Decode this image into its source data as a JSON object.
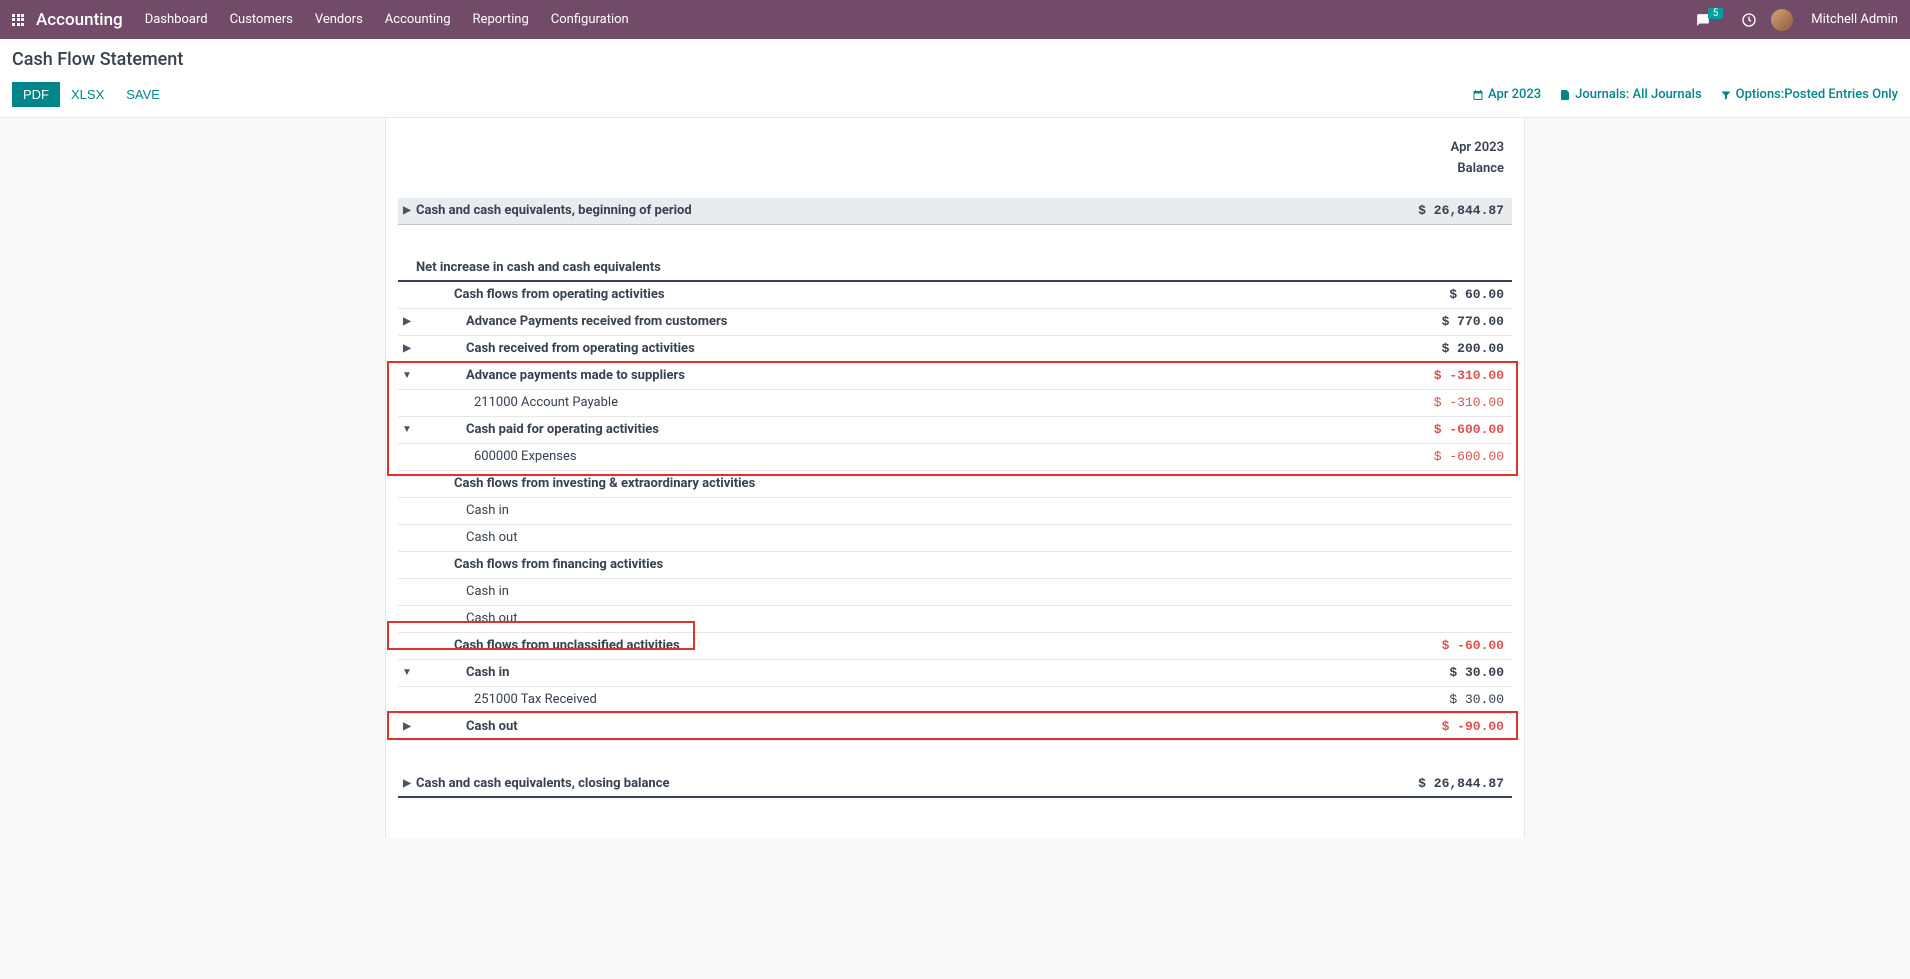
{
  "topbar": {
    "brand": "Accounting",
    "menu": [
      "Dashboard",
      "Customers",
      "Vendors",
      "Accounting",
      "Reporting",
      "Configuration"
    ],
    "notifications": "5",
    "user": "Mitchell Admin"
  },
  "page": {
    "title": "Cash Flow Statement"
  },
  "toolbar": {
    "pdf": "PDF",
    "xlsx": "XLSX",
    "save": "SAVE",
    "date_filter": "Apr 2023",
    "journals_filter": "Journals: All Journals",
    "options_filter": "Options:Posted Entries Only"
  },
  "report": {
    "period": "Apr 2023",
    "balance_label": "Balance",
    "rows": [
      {
        "label": "Cash and cash equivalents, beginning of period",
        "amount": "$ 26,844.87",
        "neg": false,
        "level": 0,
        "caret": "right",
        "shaded": true
      },
      {
        "gap": true
      },
      {
        "label": "Net increase in cash and cash equivalents",
        "amount": "",
        "neg": false,
        "level": 0,
        "caret": "",
        "section": true
      },
      {
        "label": "Cash flows from operating activities",
        "amount": "$ 60.00",
        "neg": false,
        "level": 1,
        "caret": ""
      },
      {
        "label": "Advance Payments received from customers",
        "amount": "$ 770.00",
        "neg": false,
        "level": 2,
        "caret": "right"
      },
      {
        "label": "Cash received from operating activities",
        "amount": "$ 200.00",
        "neg": false,
        "level": 2,
        "caret": "right"
      },
      {
        "label": "Advance payments made to suppliers",
        "amount": "$ -310.00",
        "neg": true,
        "level": 2,
        "caret": "down",
        "boxstart": 1
      },
      {
        "label": "211000 Account Payable",
        "amount": "$ -310.00",
        "neg": true,
        "level": 3,
        "caret": ""
      },
      {
        "label": "Cash paid for operating activities",
        "amount": "$ -600.00",
        "neg": true,
        "level": 2,
        "caret": "down"
      },
      {
        "label": "600000 Expenses",
        "amount": "$ -600.00",
        "neg": true,
        "level": 3,
        "caret": ""
      },
      {
        "label": "Cash flows from investing & extraordinary activities",
        "amount": "",
        "neg": false,
        "level": 1,
        "caret": ""
      },
      {
        "label": "Cash in",
        "amount": "",
        "neg": false,
        "level": 2,
        "caret": "",
        "plain": true
      },
      {
        "label": "Cash out",
        "amount": "",
        "neg": false,
        "level": 2,
        "caret": "",
        "plain": true
      },
      {
        "label": "Cash flows from financing activities",
        "amount": "",
        "neg": false,
        "level": 1,
        "caret": ""
      },
      {
        "label": "Cash in",
        "amount": "",
        "neg": false,
        "level": 2,
        "caret": "",
        "plain": true
      },
      {
        "label": "Cash out",
        "amount": "",
        "neg": false,
        "level": 2,
        "caret": "",
        "plain": true
      },
      {
        "label": "Cash flows from unclassified activities",
        "amount": "$ -60.00",
        "neg": true,
        "level": 1,
        "caret": "",
        "boxstart": 2
      },
      {
        "label": "Cash in",
        "amount": "$ 30.00",
        "neg": false,
        "level": 2,
        "caret": "down"
      },
      {
        "label": "251000 Tax Received",
        "amount": "$ 30.00",
        "neg": false,
        "level": 3,
        "caret": ""
      },
      {
        "label": "Cash out",
        "amount": "$ -90.00",
        "neg": true,
        "level": 2,
        "caret": "right",
        "boxstart": 3
      },
      {
        "gap": true
      },
      {
        "label": "Cash and cash equivalents, closing balance",
        "amount": "$ 26,844.87",
        "neg": false,
        "level": 0,
        "caret": "right",
        "section": true
      }
    ]
  }
}
